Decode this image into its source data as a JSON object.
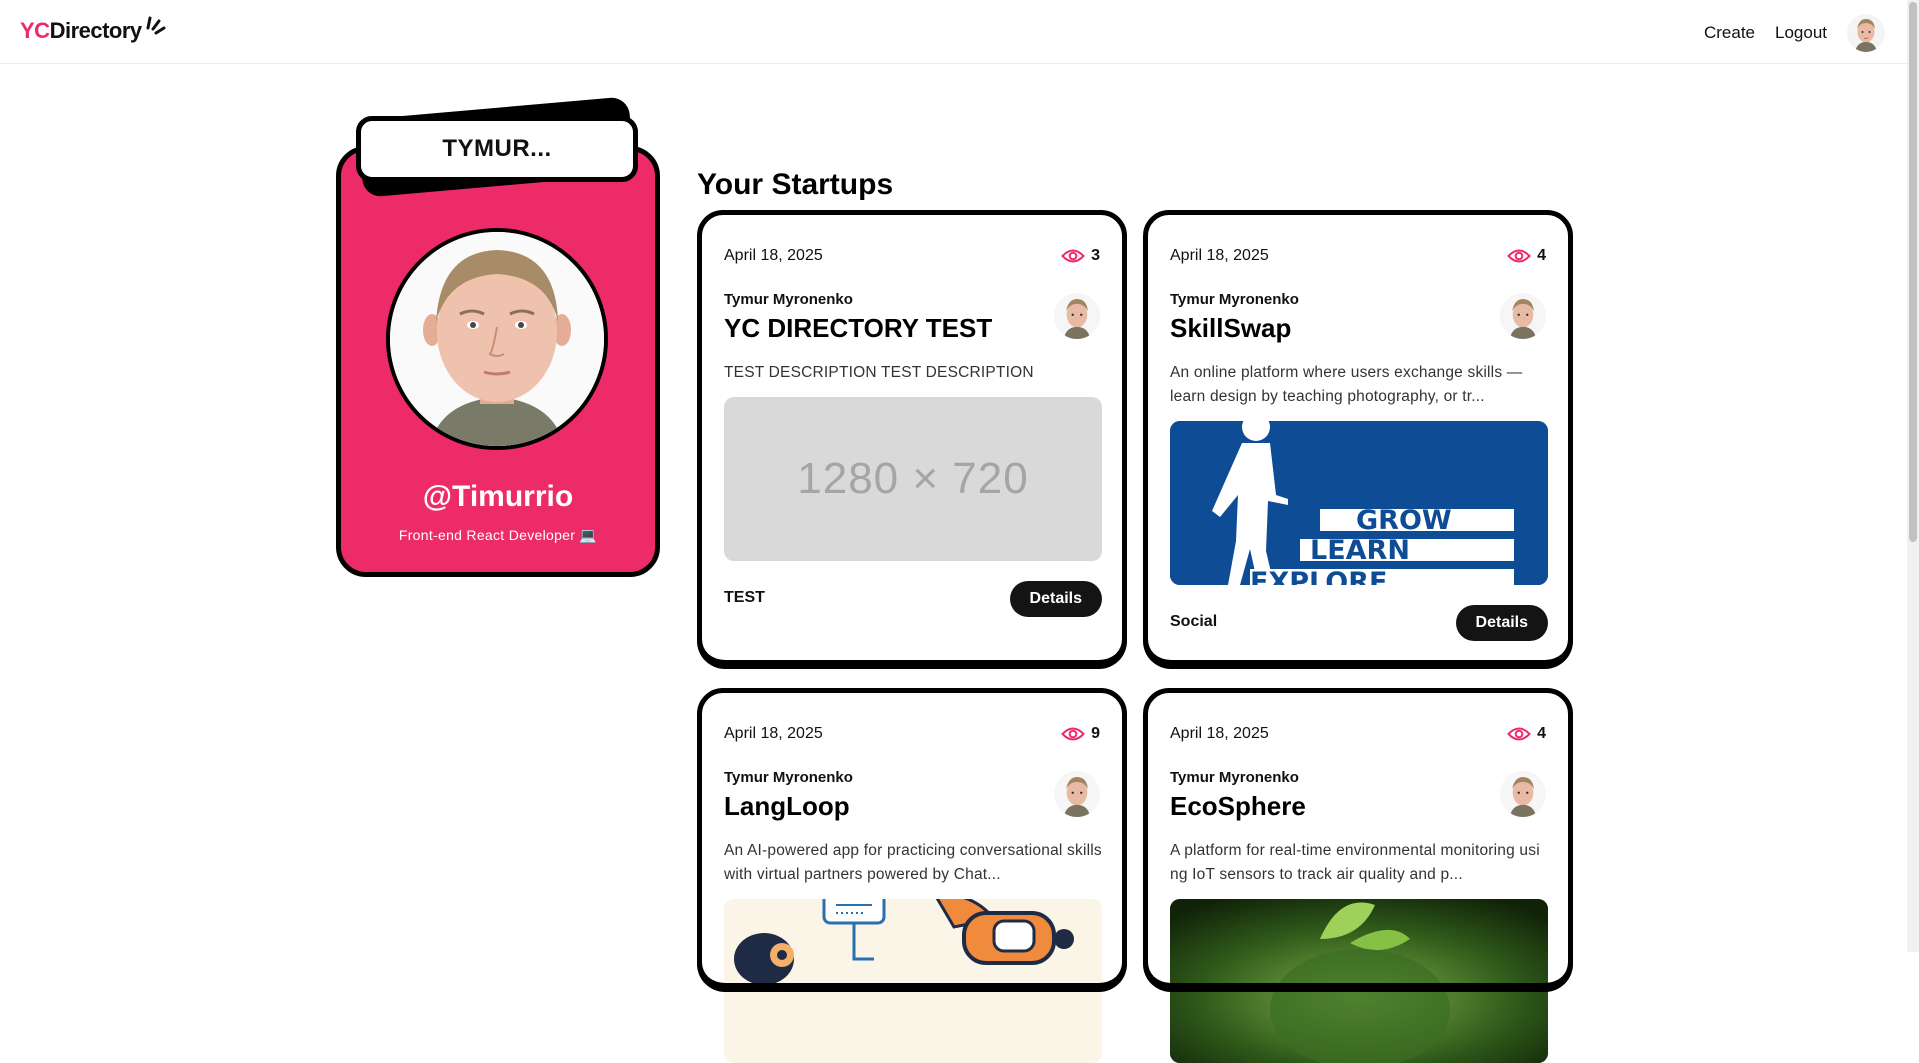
{
  "nav": {
    "logo_yc": "YC",
    "logo_rest": "Directory",
    "create_label": "Create",
    "logout_label": "Logout"
  },
  "profile": {
    "name": "TYMUR...",
    "username": "@Timurrio",
    "bio": "Front-end React Developer 💻"
  },
  "section_title": "Your Startups",
  "startups": [
    {
      "date": "April 18, 2025",
      "views": "3",
      "author": "Tymur Myronenko",
      "title": "YC DIRECTORY TEST",
      "description": "TEST DESCRIPTION TEST DESCRIPTION",
      "image_text": "1280 × 720",
      "category": "TEST",
      "details_label": "Details"
    },
    {
      "date": "April 18, 2025",
      "views": "4",
      "author": "Tymur Myronenko",
      "title": "SkillSwap",
      "description": "An online platform where users exchange skills — learn design by teaching photography, or tr...",
      "image_words": [
        "GROW",
        "LEARN",
        "EXPLORE"
      ],
      "category": "Social",
      "details_label": "Details"
    },
    {
      "date": "April 18, 2025",
      "views": "9",
      "author": "Tymur Myronenko",
      "title": "LangLoop",
      "description": "An AI-powered app for practicing conversational skills with virtual partners powered by Chat..."
    },
    {
      "date": "April 18, 2025",
      "views": "4",
      "author": "Tymur Myronenko",
      "title": "EcoSphere",
      "description": "A platform for real-time environmental monitoring using IoT sensors to track air quality and p..."
    }
  ],
  "colors": {
    "accent": "#EE2B69",
    "dark": "#141414",
    "placeholder": "#D9D9D9",
    "skillswap_blue": "#0F4C96"
  }
}
